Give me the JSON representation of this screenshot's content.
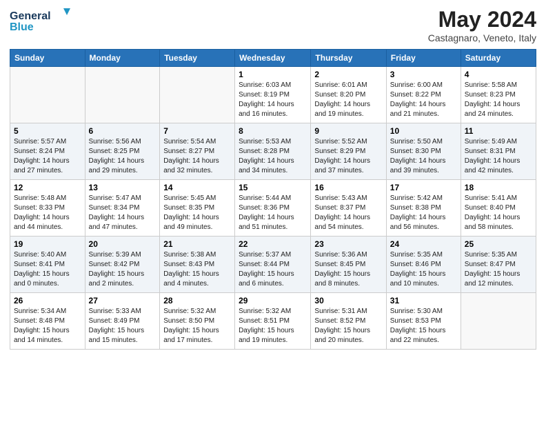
{
  "logo": {
    "line1": "General",
    "line2": "Blue"
  },
  "title": "May 2024",
  "location": "Castagnaro, Veneto, Italy",
  "days_header": [
    "Sunday",
    "Monday",
    "Tuesday",
    "Wednesday",
    "Thursday",
    "Friday",
    "Saturday"
  ],
  "weeks": [
    [
      {
        "day": "",
        "info": ""
      },
      {
        "day": "",
        "info": ""
      },
      {
        "day": "",
        "info": ""
      },
      {
        "day": "1",
        "info": "Sunrise: 6:03 AM\nSunset: 8:19 PM\nDaylight: 14 hours\nand 16 minutes."
      },
      {
        "day": "2",
        "info": "Sunrise: 6:01 AM\nSunset: 8:20 PM\nDaylight: 14 hours\nand 19 minutes."
      },
      {
        "day": "3",
        "info": "Sunrise: 6:00 AM\nSunset: 8:22 PM\nDaylight: 14 hours\nand 21 minutes."
      },
      {
        "day": "4",
        "info": "Sunrise: 5:58 AM\nSunset: 8:23 PM\nDaylight: 14 hours\nand 24 minutes."
      }
    ],
    [
      {
        "day": "5",
        "info": "Sunrise: 5:57 AM\nSunset: 8:24 PM\nDaylight: 14 hours\nand 27 minutes."
      },
      {
        "day": "6",
        "info": "Sunrise: 5:56 AM\nSunset: 8:25 PM\nDaylight: 14 hours\nand 29 minutes."
      },
      {
        "day": "7",
        "info": "Sunrise: 5:54 AM\nSunset: 8:27 PM\nDaylight: 14 hours\nand 32 minutes."
      },
      {
        "day": "8",
        "info": "Sunrise: 5:53 AM\nSunset: 8:28 PM\nDaylight: 14 hours\nand 34 minutes."
      },
      {
        "day": "9",
        "info": "Sunrise: 5:52 AM\nSunset: 8:29 PM\nDaylight: 14 hours\nand 37 minutes."
      },
      {
        "day": "10",
        "info": "Sunrise: 5:50 AM\nSunset: 8:30 PM\nDaylight: 14 hours\nand 39 minutes."
      },
      {
        "day": "11",
        "info": "Sunrise: 5:49 AM\nSunset: 8:31 PM\nDaylight: 14 hours\nand 42 minutes."
      }
    ],
    [
      {
        "day": "12",
        "info": "Sunrise: 5:48 AM\nSunset: 8:33 PM\nDaylight: 14 hours\nand 44 minutes."
      },
      {
        "day": "13",
        "info": "Sunrise: 5:47 AM\nSunset: 8:34 PM\nDaylight: 14 hours\nand 47 minutes."
      },
      {
        "day": "14",
        "info": "Sunrise: 5:45 AM\nSunset: 8:35 PM\nDaylight: 14 hours\nand 49 minutes."
      },
      {
        "day": "15",
        "info": "Sunrise: 5:44 AM\nSunset: 8:36 PM\nDaylight: 14 hours\nand 51 minutes."
      },
      {
        "day": "16",
        "info": "Sunrise: 5:43 AM\nSunset: 8:37 PM\nDaylight: 14 hours\nand 54 minutes."
      },
      {
        "day": "17",
        "info": "Sunrise: 5:42 AM\nSunset: 8:38 PM\nDaylight: 14 hours\nand 56 minutes."
      },
      {
        "day": "18",
        "info": "Sunrise: 5:41 AM\nSunset: 8:40 PM\nDaylight: 14 hours\nand 58 minutes."
      }
    ],
    [
      {
        "day": "19",
        "info": "Sunrise: 5:40 AM\nSunset: 8:41 PM\nDaylight: 15 hours\nand 0 minutes."
      },
      {
        "day": "20",
        "info": "Sunrise: 5:39 AM\nSunset: 8:42 PM\nDaylight: 15 hours\nand 2 minutes."
      },
      {
        "day": "21",
        "info": "Sunrise: 5:38 AM\nSunset: 8:43 PM\nDaylight: 15 hours\nand 4 minutes."
      },
      {
        "day": "22",
        "info": "Sunrise: 5:37 AM\nSunset: 8:44 PM\nDaylight: 15 hours\nand 6 minutes."
      },
      {
        "day": "23",
        "info": "Sunrise: 5:36 AM\nSunset: 8:45 PM\nDaylight: 15 hours\nand 8 minutes."
      },
      {
        "day": "24",
        "info": "Sunrise: 5:35 AM\nSunset: 8:46 PM\nDaylight: 15 hours\nand 10 minutes."
      },
      {
        "day": "25",
        "info": "Sunrise: 5:35 AM\nSunset: 8:47 PM\nDaylight: 15 hours\nand 12 minutes."
      }
    ],
    [
      {
        "day": "26",
        "info": "Sunrise: 5:34 AM\nSunset: 8:48 PM\nDaylight: 15 hours\nand 14 minutes."
      },
      {
        "day": "27",
        "info": "Sunrise: 5:33 AM\nSunset: 8:49 PM\nDaylight: 15 hours\nand 15 minutes."
      },
      {
        "day": "28",
        "info": "Sunrise: 5:32 AM\nSunset: 8:50 PM\nDaylight: 15 hours\nand 17 minutes."
      },
      {
        "day": "29",
        "info": "Sunrise: 5:32 AM\nSunset: 8:51 PM\nDaylight: 15 hours\nand 19 minutes."
      },
      {
        "day": "30",
        "info": "Sunrise: 5:31 AM\nSunset: 8:52 PM\nDaylight: 15 hours\nand 20 minutes."
      },
      {
        "day": "31",
        "info": "Sunrise: 5:30 AM\nSunset: 8:53 PM\nDaylight: 15 hours\nand 22 minutes."
      },
      {
        "day": "",
        "info": ""
      }
    ]
  ],
  "colors": {
    "header_bg": "#2872b8",
    "logo_dark": "#1a3a5c",
    "logo_blue": "#2196c4"
  }
}
